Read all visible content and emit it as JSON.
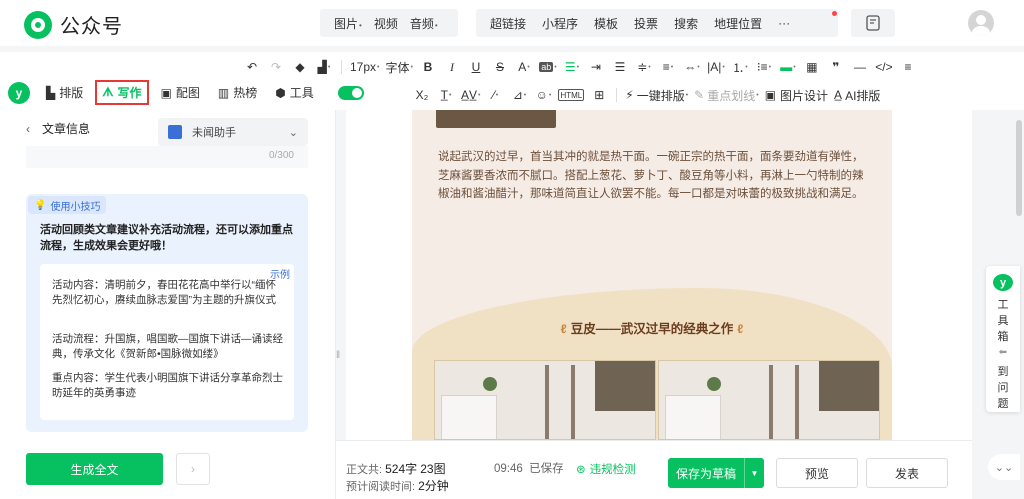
{
  "app": {
    "title": "公众号"
  },
  "header": {
    "insert_group1": [
      {
        "label": "图片",
        "has_caret": true
      },
      {
        "label": "视频",
        "has_caret": false
      },
      {
        "label": "音频",
        "has_caret": true
      }
    ],
    "insert_group2": [
      "超链接",
      "小程序",
      "模板",
      "投票",
      "搜索",
      "地理位置",
      "···"
    ]
  },
  "toolbar": {
    "font_size": "17px",
    "font_family": "字体",
    "one_click_layout": "一键排版",
    "key_highlight": "重点划线",
    "image_design": "图片设计",
    "ai_layout": "AI排版"
  },
  "left_tabs": [
    {
      "label": "排版",
      "icon": "layout-icon",
      "active": false
    },
    {
      "label": "写作",
      "icon": "writing-icon",
      "active": true
    },
    {
      "label": "配图",
      "icon": "image-icon",
      "active": false
    },
    {
      "label": "热榜",
      "icon": "hot-list-icon",
      "active": false
    },
    {
      "label": "工具",
      "icon": "tool-icon",
      "active": false
    }
  ],
  "sidebar": {
    "header_title": "文章信息",
    "assistant_name": "未闻助手",
    "char_counter": "0/300",
    "tip": {
      "badge": "使用小技巧",
      "title": "活动回顾类文章建议补充活动流程，还可以添加重点流程，生成效果会更好哦！",
      "tag": "示例",
      "p1": "活动内容：清明前夕，春田花花高中举行以“缅怀先烈忆初心，赓续血脉志爱国”为主题的升旗仪式",
      "p2": "活动流程：升国旗，唱国歌—国旗下讲话—诵读经典，传承文化《贺新郎•国脉微如缕》",
      "p3": "重点内容：学生代表小明国旗下讲话分享革命烈士昉延年的英勇事迹"
    },
    "generate_label": "生成全文"
  },
  "article": {
    "paragraph": "说起武汉的过早，首当其冲的就是热干面。一碗正宗的热干面，面条要劲道有弹性，芝麻酱要香浓而不腻口。搭配上葱花、萝卜丁、酸豆角等小料，再淋上一勺特制的辣椒油和酱油醋汁，那味道简直让人欲罢不能。每一口都是对味蕾的极致挑战和满足。",
    "subheading": "豆皮——武汉过早的经典之作"
  },
  "toolbox": {
    "label": "工具箱",
    "back_label": "到问题"
  },
  "bottom": {
    "body_label": "正文共:",
    "word_count": "524字",
    "image_count": "23图",
    "read_label": "预计阅读时间:",
    "read_time": "2分钟",
    "save_time": "09:46",
    "saved": "已保存",
    "violation_check": "违规检测",
    "save_draft": "保存为草稿",
    "preview": "预览",
    "publish": "发表"
  },
  "colors": {
    "brand": "#07c160",
    "highlight_border": "#e53935",
    "article_bg": "#f6ece6",
    "article_text": "#6b4f3a"
  }
}
